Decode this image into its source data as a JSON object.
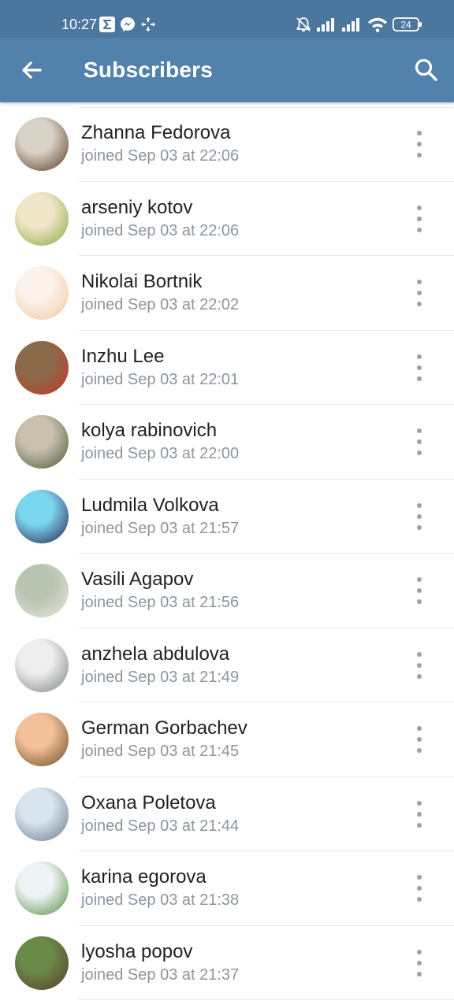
{
  "status_bar": {
    "time": "10:27",
    "battery": "24",
    "left_icons": [
      "sigma-icon",
      "messenger-icon",
      "game-icon"
    ],
    "right_icons": [
      "mute-bell-icon",
      "signal-icon",
      "signal-icon",
      "wifi-icon",
      "battery-icon"
    ]
  },
  "header": {
    "title": "Subscribers",
    "back_icon": "arrow-left-icon",
    "search_icon": "search-icon",
    "color": "#5282ab"
  },
  "subscribers": [
    {
      "name": "Zhanna Fedorova",
      "joined": "joined Sep 03 at 22:06",
      "avatar": "horse-photo",
      "bg": [
        "#d9d2c6",
        "#5a3a22"
      ]
    },
    {
      "name": "arseniy kotov",
      "joined": "joined Sep 03 at 22:06",
      "avatar": "anime-character",
      "bg": [
        "#f0e6c8",
        "#8aa840"
      ]
    },
    {
      "name": "Nikolai Bortnik",
      "joined": "joined Sep 03 at 22:02",
      "avatar": "anime-girl",
      "bg": [
        "#fbf2ec",
        "#f2c79a"
      ]
    },
    {
      "name": "Inzhu Lee",
      "joined": "joined Sep 03 at 22:01",
      "avatar": "cat-photo",
      "bg": [
        "#8a6a4a",
        "#c23a2a"
      ]
    },
    {
      "name": "kolya rabinovich",
      "joined": "joined Sep 03 at 22:00",
      "avatar": "rider-horse",
      "bg": [
        "#c9c0ae",
        "#4a5a3a"
      ]
    },
    {
      "name": "Ludmila Volkova",
      "joined": "joined Sep 03 at 21:57",
      "avatar": "anime-girl-blue",
      "bg": [
        "#7ad6ee",
        "#2a1a4a"
      ]
    },
    {
      "name": "Vasili Agapov",
      "joined": "joined Sep 03 at 21:56",
      "avatar": "white-horse",
      "bg": [
        "#b8c4b0",
        "#e8e6e0"
      ]
    },
    {
      "name": "anzhela abdulova",
      "joined": "joined Sep 03 at 21:49",
      "avatar": "grey-cat",
      "bg": [
        "#eeeeee",
        "#7c7f80"
      ]
    },
    {
      "name": "German Gorbachev",
      "joined": "joined Sep 03 at 21:45",
      "avatar": "landscape",
      "bg": [
        "#f2c09a",
        "#6a4a20"
      ]
    },
    {
      "name": "Oxana Poletova",
      "joined": "joined Sep 03 at 21:44",
      "avatar": "sky-photo",
      "bg": [
        "#d8e4ee",
        "#6a7a8a"
      ]
    },
    {
      "name": "karina egorova",
      "joined": "joined Sep 03 at 21:38",
      "avatar": "horses-field",
      "bg": [
        "#eef3f6",
        "#4f8a3a"
      ]
    },
    {
      "name": "lyosha popov",
      "joined": "joined Sep 03 at 21:37",
      "avatar": "jumping-horse",
      "bg": [
        "#6a8a4a",
        "#5a3a2a"
      ]
    }
  ]
}
